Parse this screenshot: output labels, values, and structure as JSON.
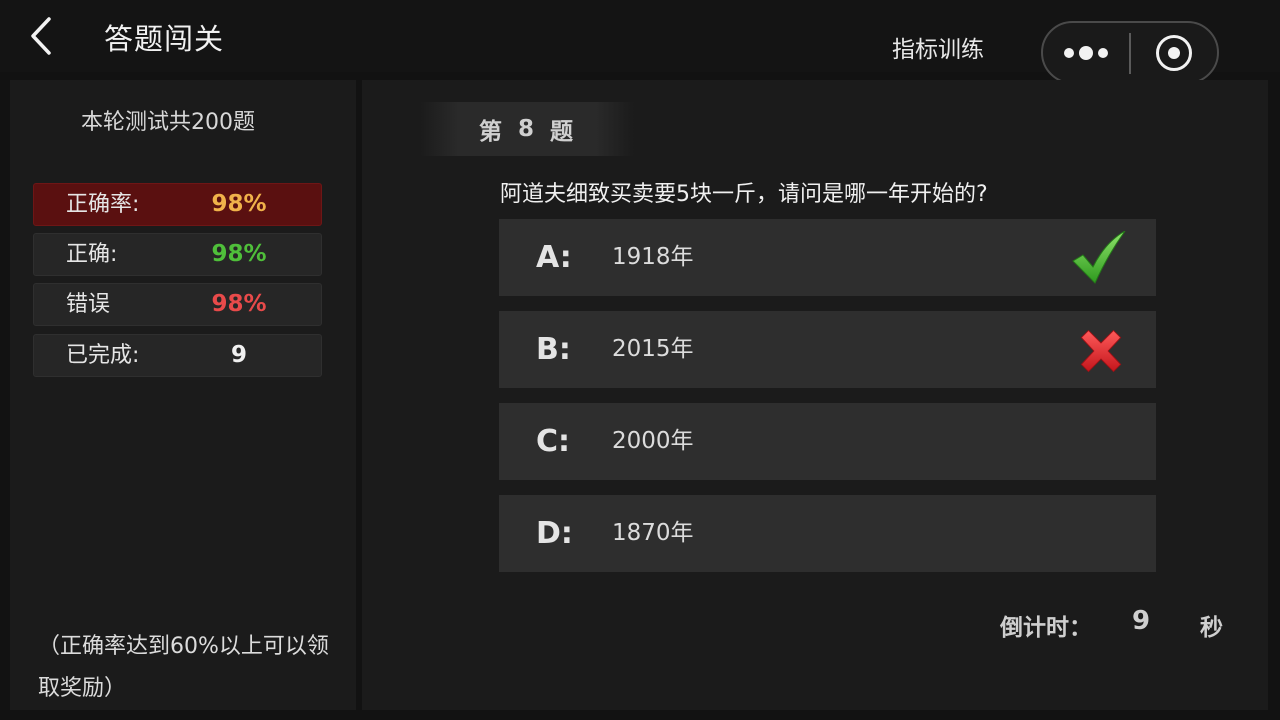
{
  "header": {
    "title": "答题闯关",
    "link_label": "指标训练"
  },
  "stats": {
    "round_info": "本轮测试共200题",
    "rows": [
      {
        "label": "正确率:",
        "value": "98%",
        "color": "#f0b24a",
        "highlight": true
      },
      {
        "label": "正确:",
        "value": "98%",
        "color": "#4fbf3a"
      },
      {
        "label": "错误",
        "value": "98%",
        "color": "#e84a4a"
      },
      {
        "label": "已完成:",
        "value": "9",
        "color": "#f0f0f0"
      }
    ],
    "note": "（正确率达到60%以上可以领取奖励）"
  },
  "quiz": {
    "qnum_prefix": "第",
    "qnum": "8",
    "qnum_suffix": "题",
    "question": "阿道夫细致买卖要5块一斤，请问是哪一年开始的?",
    "options": [
      {
        "letter": "A:",
        "text": "1918年",
        "mark": "check-icon"
      },
      {
        "letter": "B:",
        "text": "2015年",
        "mark": "cross-icon"
      },
      {
        "letter": "C:",
        "text": "2000年",
        "mark": ""
      },
      {
        "letter": "D:",
        "text": "1870年",
        "mark": ""
      }
    ],
    "countdown_label": "倒计时：",
    "countdown_value": "9",
    "countdown_unit": "秒"
  },
  "colors": {
    "correct": "#3fae2a",
    "wrong": "#d9262b",
    "highlight_row": "#5a1010"
  }
}
